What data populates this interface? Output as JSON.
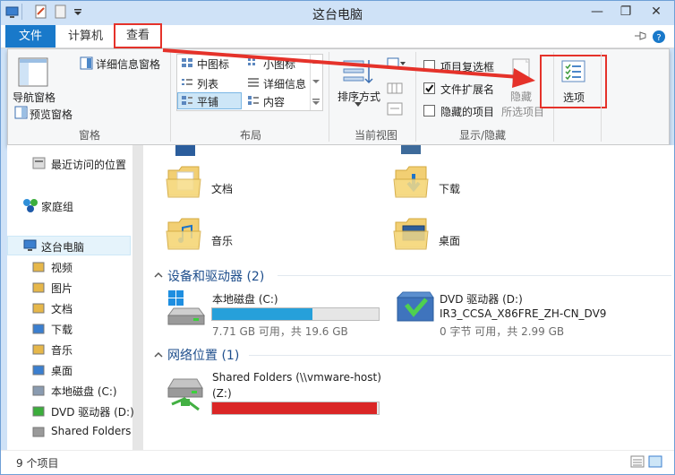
{
  "window": {
    "title": "这台电脑"
  },
  "tabs": {
    "file": "文件",
    "computer": "计算机",
    "view": "查看"
  },
  "ribbon": {
    "pane": {
      "nav_pane": "导航窗格",
      "preview_pane": "预览窗格",
      "details_pane": "详细信息窗格",
      "label": "窗格"
    },
    "layout": {
      "medium_icons": "中图标",
      "small_icons": "小图标",
      "list": "列表",
      "details": "详细信息",
      "tiles": "平铺",
      "content": "内容",
      "label": "布局"
    },
    "current_view": {
      "sort_by": "排序方式",
      "label": "当前视图"
    },
    "show_hide": {
      "item_checkboxes": "项目复选框",
      "file_extensions": "文件扩展名",
      "hidden_items": "隐藏的项目",
      "hide": "隐藏",
      "hide_selected": "所选项目",
      "label": "显示/隐藏"
    },
    "options": "选项",
    "checkbox_state": {
      "item_checkboxes": false,
      "file_extensions": true,
      "hidden_items": false
    }
  },
  "nav": {
    "recent": "最近访问的位置",
    "homegroup": "家庭组",
    "this_pc": "这台电脑",
    "items": [
      "视频",
      "图片",
      "文档",
      "下载",
      "音乐",
      "桌面",
      "本地磁盘 (C:)",
      "DVD 驱动器 (D:)",
      "Shared Folders"
    ]
  },
  "folders": [
    {
      "name": "文档"
    },
    {
      "name": "下载"
    },
    {
      "name": "音乐"
    },
    {
      "name": "桌面"
    }
  ],
  "devices": {
    "heading": "设备和驱动器 (2)",
    "drives": [
      {
        "name": "本地磁盘 (C:)",
        "free": "7.71 GB 可用，共 19.6 GB",
        "used_fraction": 0.6
      },
      {
        "name": "DVD 驱动器 (D:)",
        "label": "IR3_CCSA_X86FRE_ZH-CN_DV9",
        "free": "0 字节 可用，共 2.99 GB"
      }
    ]
  },
  "network": {
    "heading": "网络位置 (1)",
    "items": [
      {
        "name": "Shared Folders (\\\\vmware-host)",
        "drive": "(Z:)",
        "used_fraction": 0.99
      }
    ]
  },
  "status": {
    "count": "9 个项目"
  },
  "colors": {
    "accent": "#1979ca",
    "highlight": "#e5322a",
    "bar_blue": "#26a0da",
    "bar_red": "#da2626"
  }
}
